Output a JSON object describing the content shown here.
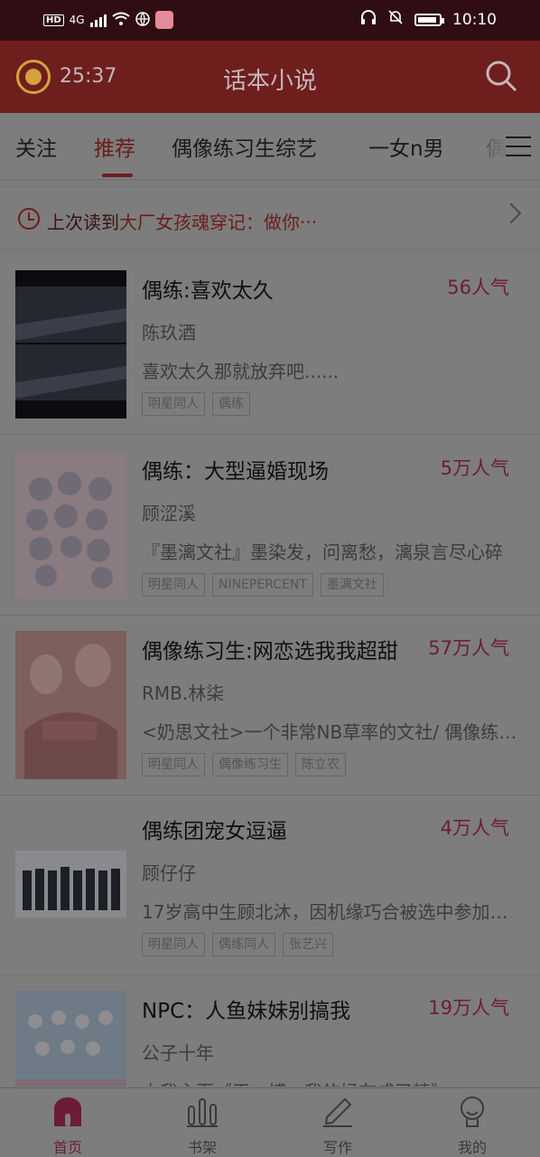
{
  "status_bar": {
    "network": "4G",
    "hd": "HD",
    "time": "10:10"
  },
  "header": {
    "timer": "25:37",
    "title": "话本小说",
    "icons": {
      "alarm": "alarm-clock-icon",
      "search": "search-icon"
    }
  },
  "tabs": [
    "关注",
    "推荐",
    "偶像练习生综艺",
    "一女n男",
    "偶"
  ],
  "active_tab": "推荐",
  "last_read": {
    "prefix": "上次读到",
    "title": "大厂女孩魂穿记：做你···"
  },
  "books": [
    {
      "title": "偶练:喜欢太久",
      "popularity": "56人气",
      "author": "陈玖酒",
      "desc": "喜欢太久那就放弃吧......",
      "tags": [
        "明星同人",
        "偶练"
      ]
    },
    {
      "title": "偶练：大型逼婚现场",
      "popularity": "5万人气",
      "author": "顾涩溪",
      "desc": "『墨漓文社』墨染发，问离愁，漓泉言尽心碎",
      "tags": [
        "明星同人",
        "NINEPERCENT",
        "墨漓文社"
      ]
    },
    {
      "title": "偶像练习生:网恋选我我超甜",
      "popularity": "57万人气",
      "author": "RMB.林柒",
      "desc": "<奶思文社>一个非常NB草率的文社/ 偶像练习生",
      "tags": [
        "明星同人",
        "偶像练习生",
        "陈立农"
      ]
    },
    {
      "title": "偶练团宠女逗逼",
      "popularity": "4万人气",
      "author": "顾仔仔",
      "desc": "17岁高中生顾北沐，因机缘巧合被选中参加偶练",
      "tags": [
        "明星同人",
        "偶练同人",
        "张艺兴"
      ]
    },
    {
      "title": "NPC：人鱼妹妹别搞我",
      "popularity": "19万人气",
      "author": "公子十年",
      "desc": "占我主页《王一博，我的妈在成了精》",
      "tags": []
    }
  ],
  "bottom_nav": [
    "首页",
    "书架",
    "写作",
    "我的"
  ],
  "colors": {
    "header_bg": "#6f1e1e",
    "accent": "#6d1c38",
    "overlay": "dimmed"
  }
}
